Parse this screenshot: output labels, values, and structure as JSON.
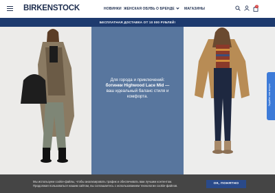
{
  "header": {
    "logo": "BIRKENSTOCK",
    "nav": [
      "НОВИНКИ",
      "ЖЕНСКАЯ ОБУВЬ",
      "О БРЕНДЕ",
      "МАГАЗИНЫ"
    ],
    "cart_count": "0",
    "icons": [
      "menu-icon",
      "search-icon",
      "user-icon",
      "cart-icon",
      "chevron-down-icon"
    ]
  },
  "promo": {
    "text": "БЕСПЛАТНАЯ ДОСТАВКА ОТ 10 000 РУБЛЕЙ!"
  },
  "hero": {
    "line1": "Для города и приключений:",
    "line2": "ботинки Highwood Lace Mid —",
    "line3": "ваш идеальный баланс стиля и",
    "line4": "комфорта."
  },
  "side_tab": {
    "label": "Задайте нам вопрос"
  },
  "cookie": {
    "text1": "Мы используем cookie-файлы, чтобы анализировать трафик и обеспечивать вам лучшим контентом.",
    "text2": "Продолжая пользоваться нашим сайтом, вы соглашаетесь с использованием технологии cookie-файлов.",
    "button": "ОК, ПОНЯТНО"
  },
  "colors": {
    "navy": "#1d2d4e",
    "promo_bg": "#1d3a6e",
    "hero_mid": "#58769e",
    "side_tab": "#3d7bd8",
    "cookie_bg": "#454545",
    "cookie_button": "#2a4a8a"
  }
}
